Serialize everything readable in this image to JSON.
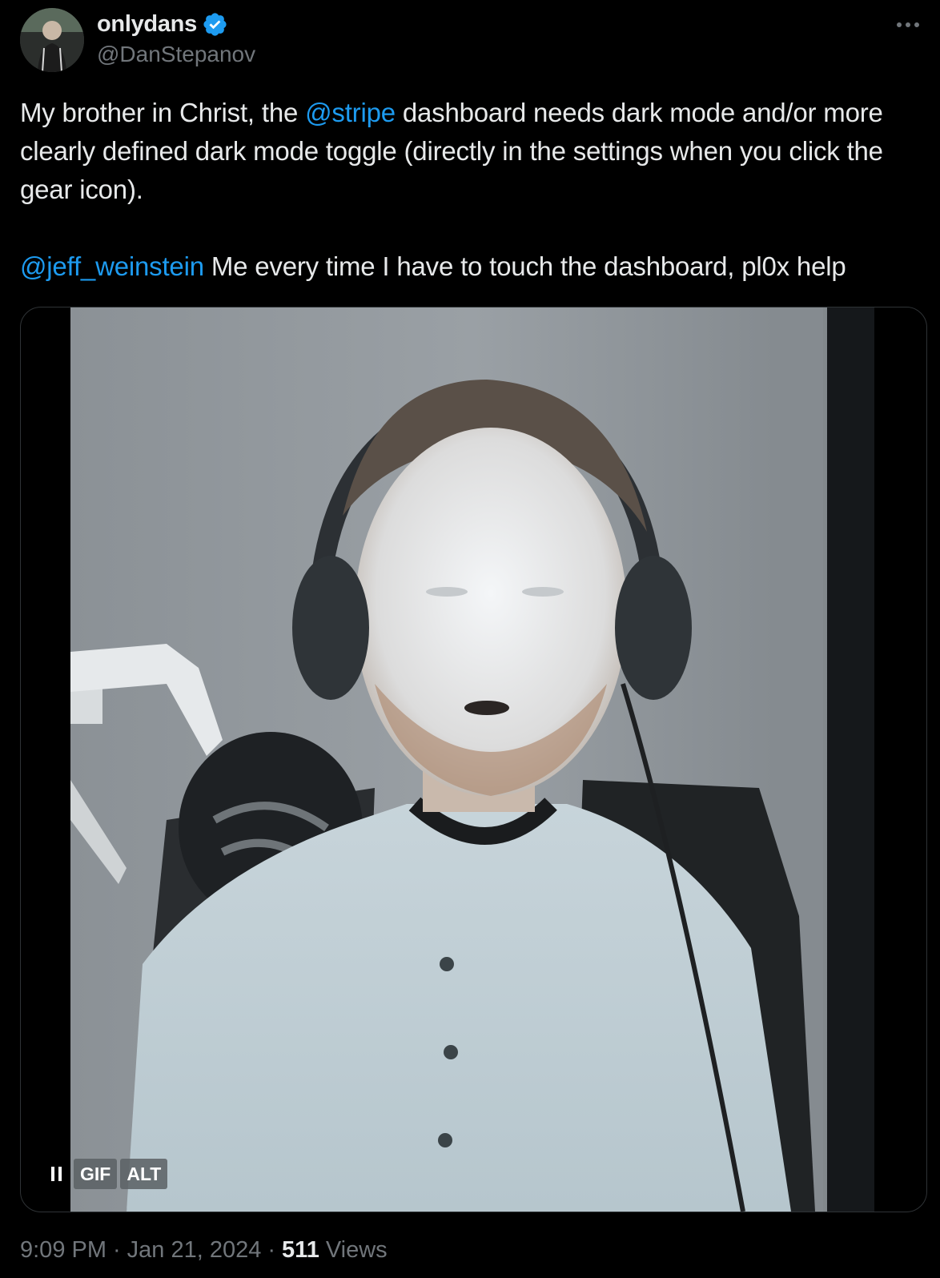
{
  "author": {
    "display_name": "onlydans",
    "handle": "@DanStepanov",
    "verified": true,
    "verified_color": "#1d9bf0"
  },
  "tweet": {
    "line1_before": "My brother in Christ, the ",
    "mention_1": "@stripe",
    "line1_after": " dashboard needs dark mode and/or more clearly defined dark mode toggle (directly in the settings when you click the gear icon).",
    "mention_2": "@jeff_weinstein",
    "line2_after": " Me every time I have to touch the dashboard, pl0x help"
  },
  "media": {
    "type": "gif",
    "gif_badge": "GIF",
    "alt_badge": "ALT",
    "pause_icon": "pause-icon"
  },
  "meta": {
    "time": "9:09 PM",
    "separator": "·",
    "date": "Jan 21, 2024",
    "views_count": "511",
    "views_label": "Views"
  },
  "colors": {
    "background": "#000000",
    "text": "#e7e9ea",
    "secondary": "#71767b",
    "link": "#1d9bf0"
  }
}
